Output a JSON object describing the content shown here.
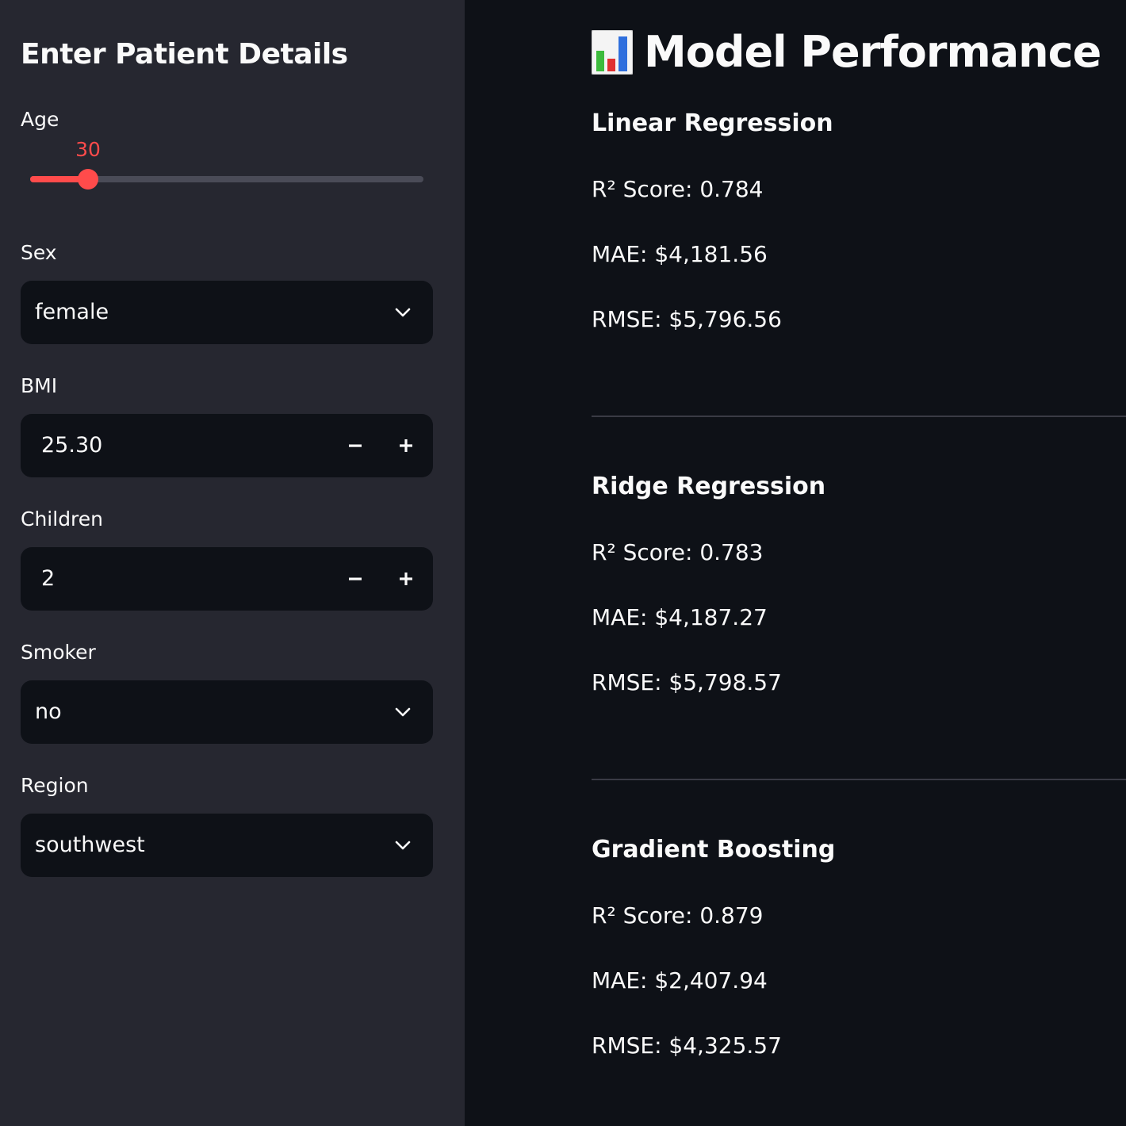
{
  "sidebar": {
    "title": "Enter Patient Details",
    "age": {
      "label": "Age",
      "value": "30",
      "fraction": 0.147
    },
    "sex": {
      "label": "Sex",
      "value": "female"
    },
    "bmi": {
      "label": "BMI",
      "value": "25.30",
      "minus": "−",
      "plus": "+"
    },
    "children": {
      "label": "Children",
      "value": "2",
      "minus": "−",
      "plus": "+"
    },
    "smoker": {
      "label": "Smoker",
      "value": "no"
    },
    "region": {
      "label": "Region",
      "value": "southwest"
    }
  },
  "main": {
    "title": "Model Performance",
    "title_icon": "bar-chart-emoji-icon",
    "models": [
      {
        "name": "Linear Regression",
        "r2": "R² Score: 0.784",
        "mae": "MAE: $4,181.56",
        "rmse": "RMSE: $5,796.56"
      },
      {
        "name": "Ridge Regression",
        "r2": "R² Score: 0.783",
        "mae": "MAE: $4,187.27",
        "rmse": "RMSE: $5,798.57"
      },
      {
        "name": "Gradient Boosting",
        "r2": "R² Score: 0.879",
        "mae": "MAE: $2,407.94",
        "rmse": "RMSE: $4,325.57"
      }
    ]
  },
  "colors": {
    "accent": "#ff4b4b",
    "sidebar_bg": "#262730",
    "main_bg": "#0e1117",
    "text": "#fafafa"
  }
}
